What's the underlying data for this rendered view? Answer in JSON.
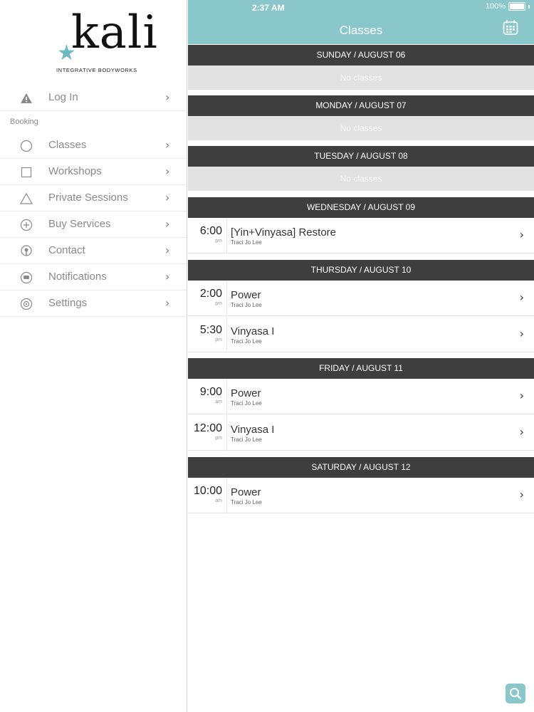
{
  "status_bar": {
    "time": "2:37 AM",
    "battery": "100%"
  },
  "brand": {
    "logo_text": "kali",
    "logo_subtitle": "INTEGRATIVE BODYWORKS"
  },
  "sidebar": {
    "login": {
      "label": "Log In",
      "icon": "warning-icon"
    },
    "section_label": "Booking",
    "items": [
      {
        "label": "Classes",
        "icon": "circle-icon"
      },
      {
        "label": "Workshops",
        "icon": "square-icon"
      },
      {
        "label": "Private Sessions",
        "icon": "triangle-icon"
      },
      {
        "label": "Buy Services",
        "icon": "plus-circle-icon"
      },
      {
        "label": "Contact",
        "icon": "location-pin-icon"
      },
      {
        "label": "Notifications",
        "icon": "chat-bubble-icon"
      },
      {
        "label": "Settings",
        "icon": "gear-icon"
      }
    ]
  },
  "header": {
    "title": "Classes"
  },
  "days": [
    {
      "label": "SUNDAY / AUGUST 06",
      "empty_text": "No classes"
    },
    {
      "label": "MONDAY / AUGUST 07",
      "empty_text": "No classes"
    },
    {
      "label": "TUESDAY / AUGUST 08",
      "empty_text": "No classes"
    },
    {
      "label": "WEDNESDAY / AUGUST 09",
      "classes": [
        {
          "time": "6:00",
          "ampm": "pm",
          "name": "[Yin+Vinyasa] Restore",
          "teacher": "Traci Jo Lee"
        }
      ]
    },
    {
      "label": "THURSDAY / AUGUST 10",
      "classes": [
        {
          "time": "2:00",
          "ampm": "pm",
          "name": "Power",
          "teacher": "Traci Jo Lee"
        },
        {
          "time": "5:30",
          "ampm": "pm",
          "name": "Vinyasa I",
          "teacher": "Traci Jo Lee"
        }
      ]
    },
    {
      "label": "FRIDAY / AUGUST 11",
      "classes": [
        {
          "time": "9:00",
          "ampm": "am",
          "name": "Power",
          "teacher": "Traci Jo Lee"
        },
        {
          "time": "12:00",
          "ampm": "pm",
          "name": "Vinyasa I",
          "teacher": "Traci Jo Lee"
        }
      ]
    },
    {
      "label": "SATURDAY / AUGUST 12",
      "classes": [
        {
          "time": "10:00",
          "ampm": "am",
          "name": "Power",
          "teacher": "Traci Jo Lee"
        }
      ]
    }
  ],
  "colors": {
    "accent": "#8ac7cb",
    "day_header_bg": "#3e3e3e",
    "empty_bg": "#e2e2e2"
  }
}
